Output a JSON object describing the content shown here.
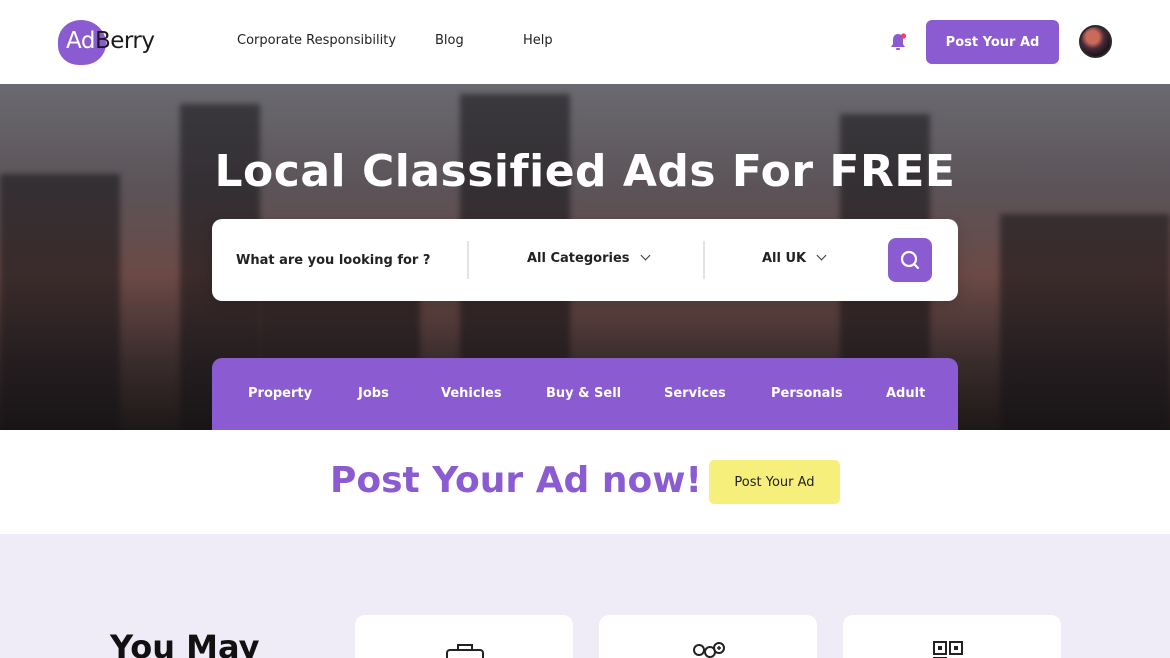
{
  "header": {
    "logo": {
      "ad": "Ad",
      "berry": "Berry"
    },
    "nav": [
      "Corporate Responsibility",
      "Blog",
      "Help"
    ],
    "post_button": "Post Your Ad",
    "icons": {
      "bell": "bell-icon",
      "avatar": "user-avatar"
    }
  },
  "hero": {
    "title": "Local Classified Ads For FREE",
    "search": {
      "placeholder": "What are you looking for ?",
      "category": "All Categories",
      "location": "All UK",
      "button_icon": "search-icon"
    },
    "categories": [
      "Property",
      "Jobs",
      "Vehicles",
      "Buy & Sell",
      "Services",
      "Personals",
      "Adult"
    ]
  },
  "cta": {
    "title": "Post Your Ad now!",
    "button": "Post Your Ad"
  },
  "lower": {
    "heading": "You May",
    "card_icons": [
      "briefcase-icon",
      "people-icon",
      "qr-grid-icon"
    ]
  },
  "colors": {
    "accent": "#8a5bd1",
    "cta_button": "#f7ef7c",
    "lower_bg": "#efebf7"
  }
}
